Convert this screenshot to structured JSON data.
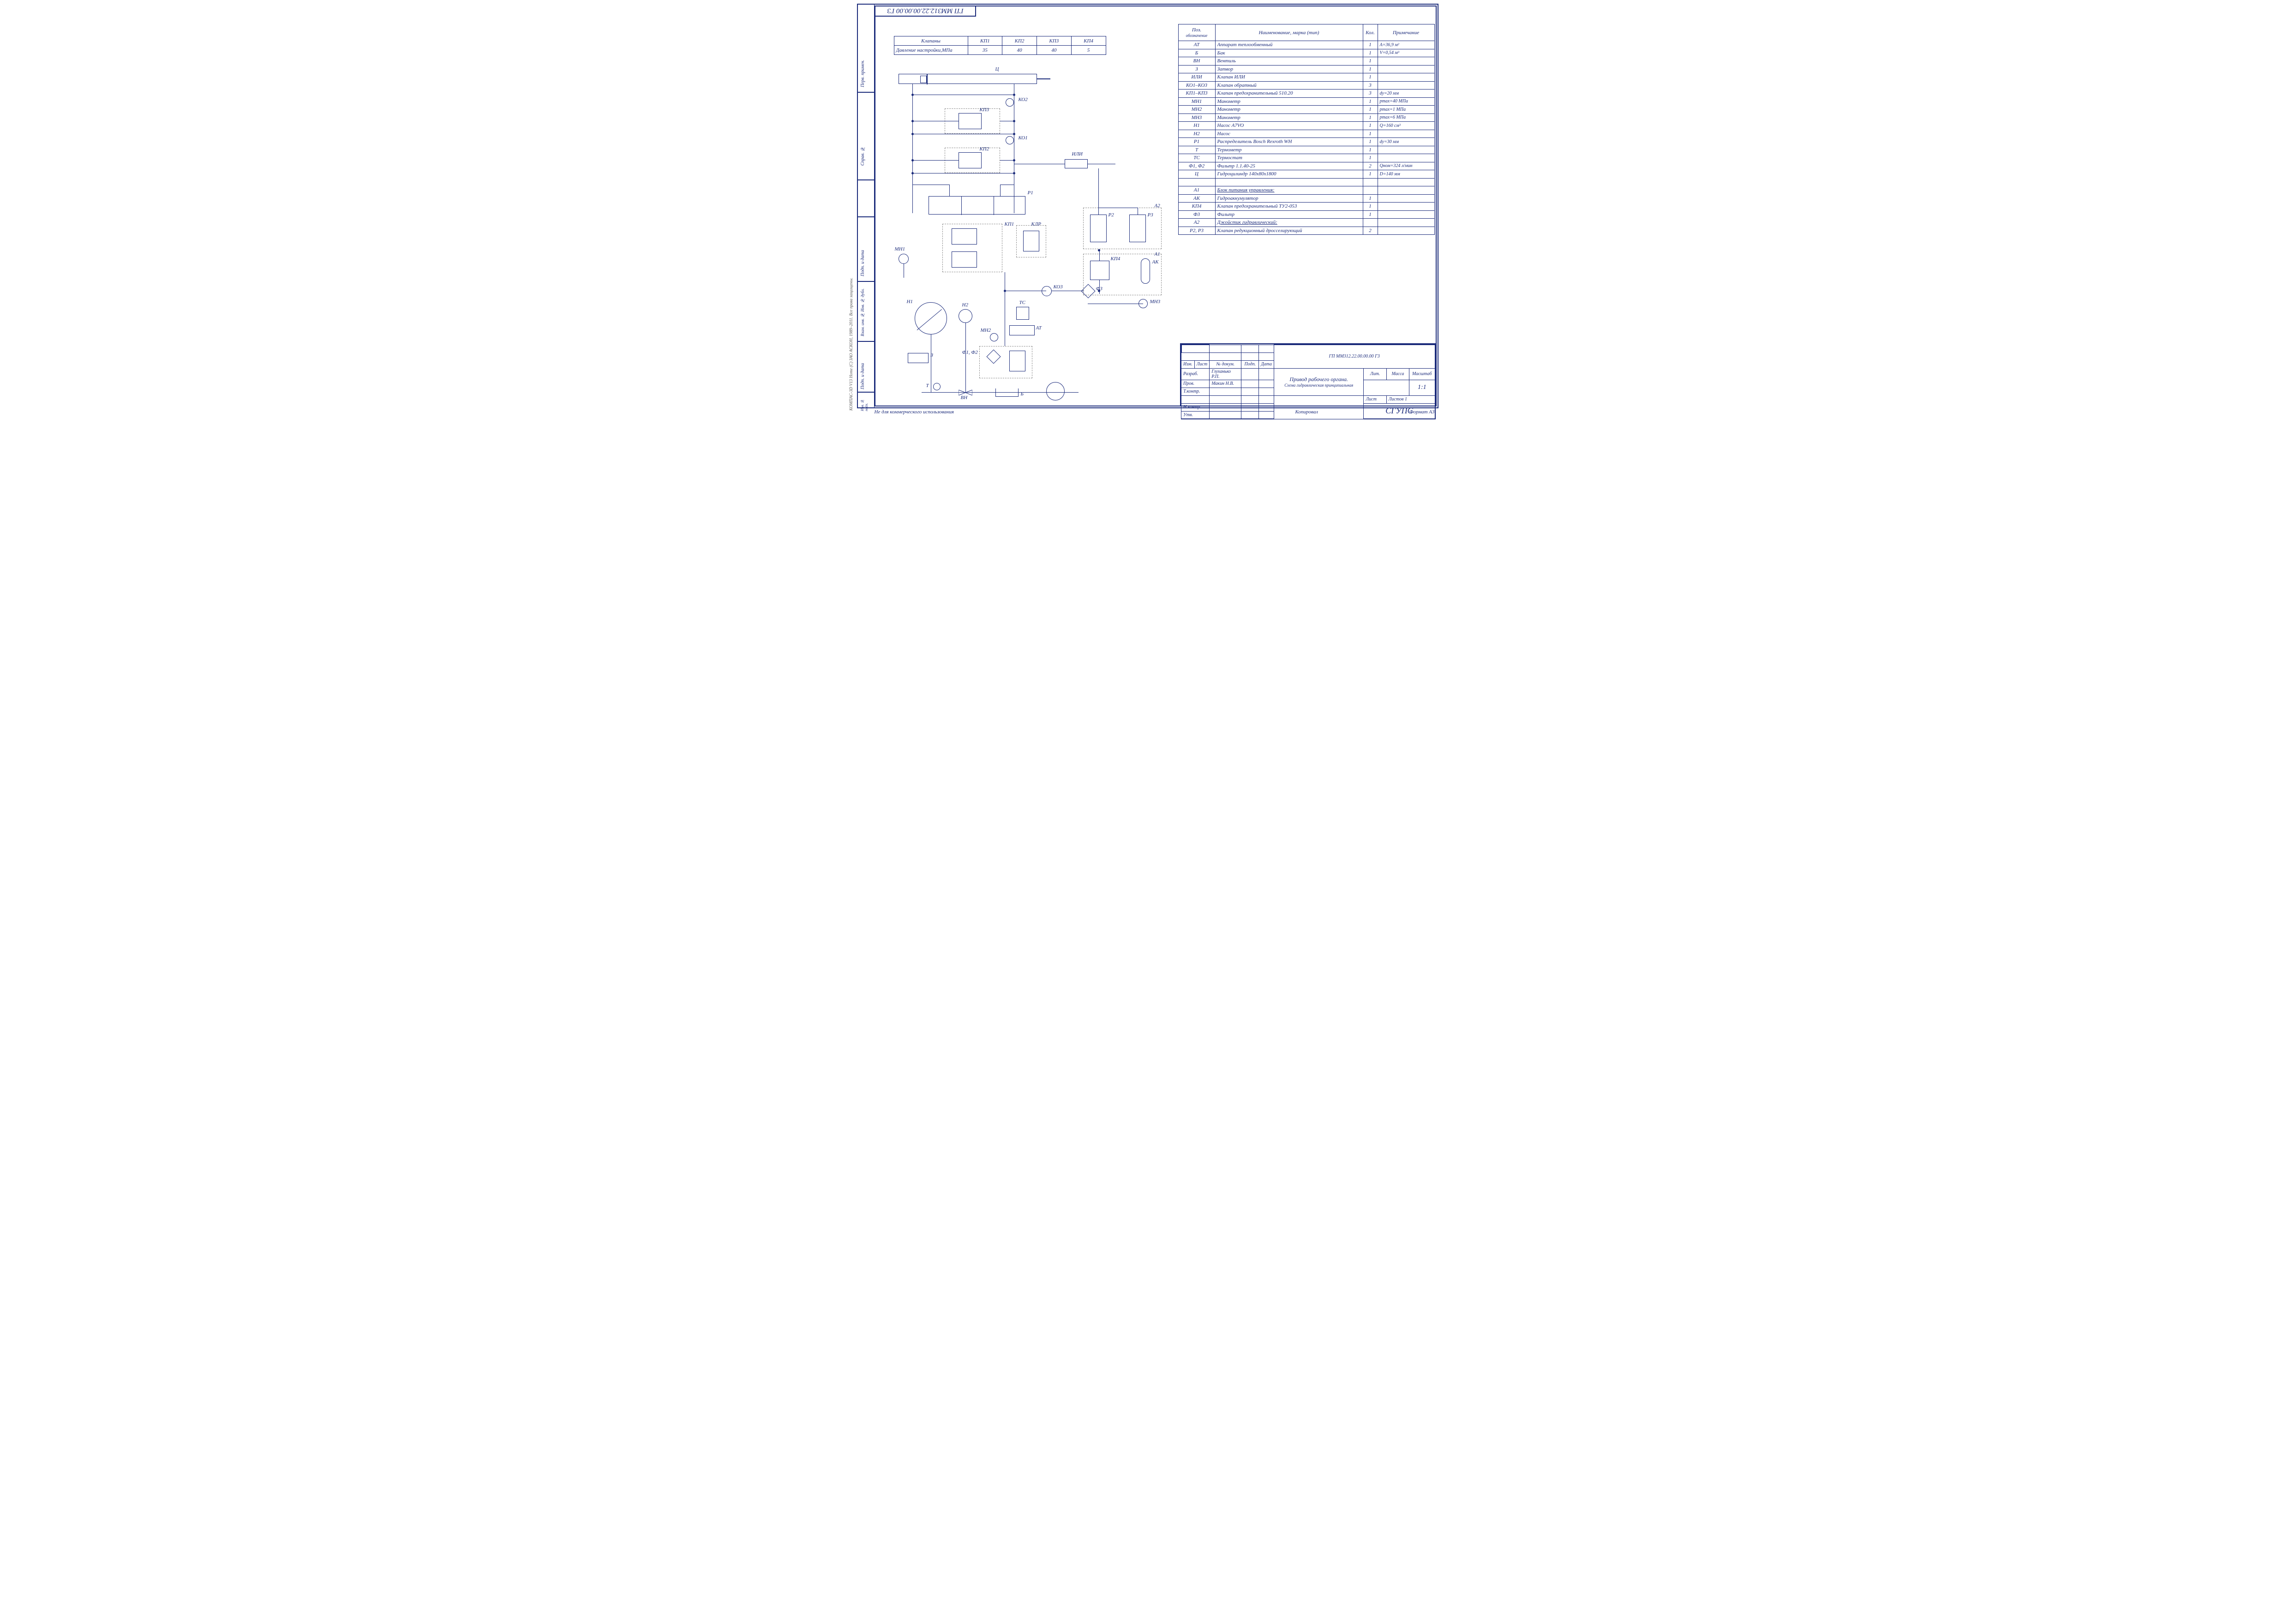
{
  "drawing_number_top": "ГП ММ312.22.00.00.00 Г3",
  "drawing_number_tb": "ГП ММ312.22.00.00.00 Г3",
  "valves_table": {
    "row1_label": "Клапаны",
    "row2_label": "Давление настройки,МПа",
    "cols": [
      "КП1",
      "КП2",
      "КП3",
      "КП4"
    ],
    "vals": [
      "35",
      "40",
      "40",
      "5"
    ]
  },
  "bom": {
    "head": {
      "pos": "Поз.",
      "pos2": "обозначение",
      "name": "Наименование, марка (тип)",
      "qty": "Кол.",
      "note": "Примечание"
    },
    "rows": [
      {
        "pos": "АТ",
        "name": "Аппарат теплообменный",
        "qty": "1",
        "note": "А=36,9 м²"
      },
      {
        "pos": "Б",
        "name": "Бак",
        "qty": "1",
        "note": "V=0,54 м³"
      },
      {
        "pos": "ВН",
        "name": "Вентиль",
        "qty": "1",
        "note": ""
      },
      {
        "pos": "З",
        "name": "Затвор",
        "qty": "1",
        "note": ""
      },
      {
        "pos": "ИЛИ",
        "name": "Клапан ИЛИ",
        "qty": "1",
        "note": ""
      },
      {
        "pos": "КО1–КО3",
        "name": "Клапан обратный",
        "qty": "3",
        "note": ""
      },
      {
        "pos": "КП1–КП3",
        "name": "Клапан предохранительный 510.20",
        "qty": "3",
        "note": "dу=20 мм"
      },
      {
        "pos": "МН1",
        "name": "Манометр",
        "qty": "1",
        "note": "pmax=40 МПа"
      },
      {
        "pos": "МН2",
        "name": "Манометр",
        "qty": "1",
        "note": "pmax=1 МПа"
      },
      {
        "pos": "МН3",
        "name": "Манометр",
        "qty": "1",
        "note": "pmax=6 МПа"
      },
      {
        "pos": "Н1",
        "name": "Насос A7VO",
        "qty": "1",
        "note": "Q=160 см³"
      },
      {
        "pos": "Н2",
        "name": "Насос",
        "qty": "1",
        "note": ""
      },
      {
        "pos": "Р1",
        "name": "Распределитель Bosch Rexroth WH",
        "qty": "1",
        "note": "dу=30 мм"
      },
      {
        "pos": "Т",
        "name": "Термометр",
        "qty": "1",
        "note": ""
      },
      {
        "pos": "ТС",
        "name": "Термостат",
        "qty": "1",
        "note": ""
      },
      {
        "pos": "Ф1, Ф2",
        "name": "Фильтр 1.1.40-25",
        "qty": "2",
        "note": "Qном=324 л/мин"
      },
      {
        "pos": "Ц",
        "name": "Гидроцилиндр 140х80х1800",
        "qty": "1",
        "note": "D=140 мм"
      },
      {
        "pos": "",
        "name": "",
        "qty": "",
        "note": ""
      },
      {
        "pos": "А1",
        "name": "Блок питания управления:",
        "qty": "",
        "note": "",
        "u": true
      },
      {
        "pos": "АК",
        "name": "Гидроаккумулятор",
        "qty": "1",
        "note": ""
      },
      {
        "pos": "КП4",
        "name": "Клапан предохранительный ТУ2-053",
        "qty": "1",
        "note": ""
      },
      {
        "pos": "Ф3",
        "name": "Фильтр",
        "qty": "1",
        "note": ""
      },
      {
        "pos": "А2",
        "name": "Джойстик гидравлический:",
        "qty": "",
        "note": "",
        "u": true
      },
      {
        "pos": "Р2, Р3",
        "name": "Клапан редукционный дросселирующий",
        "qty": "2",
        "note": ""
      }
    ]
  },
  "side": {
    "top": "Перв. примен.",
    "mid": "Справ. №",
    "b1": "Подп. и дата",
    "b2": "Взам. инв. №  Инв. № дубл.",
    "b3": "Подп. и дата",
    "b4": "Инв. № подл.",
    "watermark": "КОМПАС-3D V13 Home (C) ЗАО АСКОН, 1989–2011. Все права защищены."
  },
  "footer_left": "Не для коммерческого использования",
  "footer_mid": "Копировал",
  "footer_right": "Формат     А3",
  "tb": {
    "title1": "Привод рабочего органа.",
    "title2": "Схема гидравлическая принципиальная",
    "cols": {
      "izm": "Изм.",
      "list": "Лист",
      "ndoc": "№ докум.",
      "podp": "Подп.",
      "data": "Дата"
    },
    "rows": {
      "razrab": "Разраб.",
      "prov": "Пров.",
      "tkontr": "Т.контр.",
      "nkontr": "Н.контр.",
      "utv": "Утв."
    },
    "names": {
      "razrab": "Глуханько Р.П.",
      "prov": "Макин Н.В."
    },
    "lit": "Лит.",
    "massa": "Масса",
    "scale_h": "Масштаб",
    "scale": "1:1",
    "list": "Лист",
    "listov": "Листов     1",
    "org": "СГУПС"
  },
  "schematic_labels": {
    "C": "Ц",
    "KO2": "КО2",
    "KP3": "КП3",
    "KO1": "КО1",
    "KP2": "КП2",
    "ILI": "ИЛИ",
    "P1": "Р1",
    "KP1": "КП1",
    "KLR": "КЛР",
    "A2": "А2",
    "P2": "Р2",
    "P3": "Р3",
    "KP4": "КП4",
    "AK": "АК",
    "A1": "А1",
    "F3": "Ф3",
    "KO3": "КО3",
    "MN1": "МН1",
    "MN3": "МН3",
    "H1": "Н1",
    "H2": "Н2",
    "TS": "ТС",
    "AT": "АТ",
    "MN2": "МН2",
    "Z": "З",
    "F12": "Ф1, Ф2",
    "T": "Т",
    "B": "Б",
    "VN": "ВН"
  }
}
